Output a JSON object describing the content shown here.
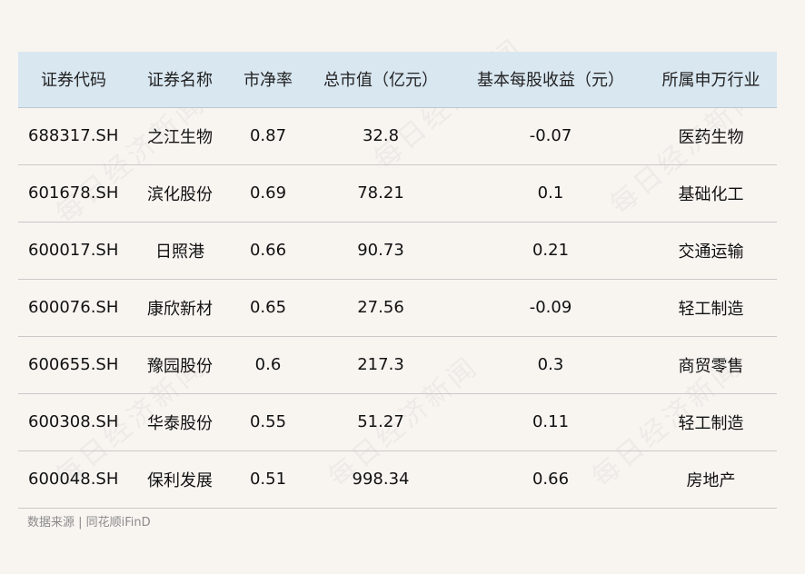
{
  "table": {
    "headers": [
      "证券代码",
      "证券名称",
      "市净率",
      "总市值（亿元）",
      "基本每股收益（元）",
      "所属申万行业"
    ],
    "rows": [
      [
        "688317.SH",
        "之江生物",
        "0.87",
        "32.8",
        "-0.07",
        "医药生物"
      ],
      [
        "601678.SH",
        "滨化股份",
        "0.69",
        "78.21",
        "0.1",
        "基础化工"
      ],
      [
        "600017.SH",
        "日照港",
        "0.66",
        "90.73",
        "0.21",
        "交通运输"
      ],
      [
        "600076.SH",
        "康欣新材",
        "0.65",
        "27.56",
        "-0.09",
        "轻工制造"
      ],
      [
        "600655.SH",
        "豫园股份",
        "0.6",
        "217.3",
        "0.3",
        "商贸零售"
      ],
      [
        "600308.SH",
        "华泰股份",
        "0.55",
        "51.27",
        "0.11",
        "轻工制造"
      ],
      [
        "600048.SH",
        "保利发展",
        "0.51",
        "998.34",
        "0.66",
        "房地产"
      ]
    ]
  },
  "source": "数据来源 | 同花顺iFinD",
  "watermark": "每日经济新闻",
  "colors": {
    "background": "#f8f5f1",
    "header_background": "#d9e7f1",
    "divider": "#c9c9c9"
  }
}
